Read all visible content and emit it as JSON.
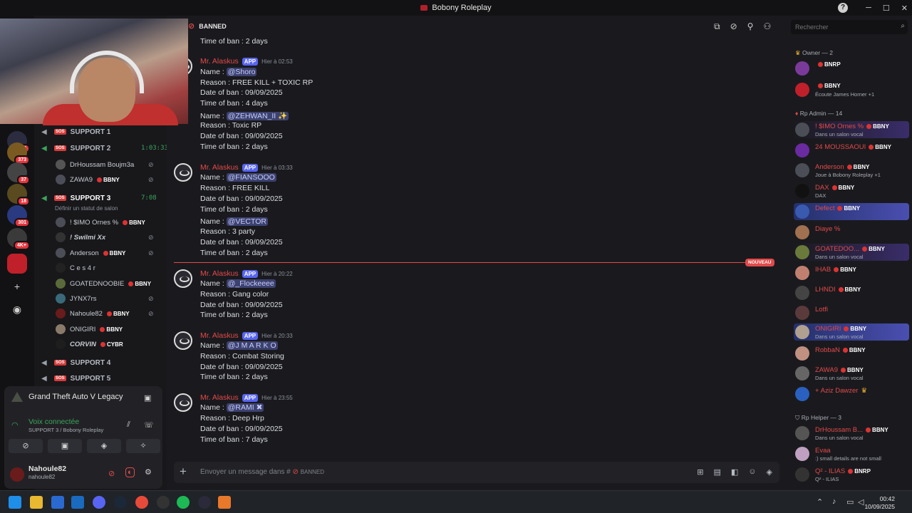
{
  "window": {
    "title": "Bobony Roleplay"
  },
  "servers": [
    {
      "badge": "96"
    },
    {
      "badge": "373"
    },
    {
      "badge": "37"
    },
    {
      "badge": "18"
    },
    {
      "badge": "301"
    },
    {
      "badge": "4K+"
    }
  ],
  "channels": {
    "support1": {
      "name": "SUPPORT 1"
    },
    "support2": {
      "name": "SUPPORT 2",
      "timer": "1:03:33"
    },
    "support2_members": [
      {
        "name": "DrHoussam Boujm3a"
      },
      {
        "name": "ZAWA9",
        "tag": "BBNY"
      }
    ],
    "support3": {
      "name": "SUPPORT 3",
      "timer": "7:08",
      "status": "Définir un statut de salon"
    },
    "support3_members": [
      {
        "name": "! $IMO Ornes %",
        "tag": "BBNY"
      },
      {
        "name": "! Swilmi Xx",
        "tag": ""
      },
      {
        "name": "Anderson",
        "tag": "BBNY"
      },
      {
        "name": "C e s 4 r",
        "tag": ""
      },
      {
        "name": "GOATEDNOOBIE",
        "tag": "BBNY"
      },
      {
        "name": "JYNX7rs",
        "tag": ""
      },
      {
        "name": "Nahoule82",
        "tag": "BBNY"
      },
      {
        "name": "ONIGIRI",
        "tag": "BBNY"
      },
      {
        "name": "CORVIN",
        "tag": "CYBR"
      }
    ],
    "support4": {
      "name": "SUPPORT 4"
    },
    "support5": {
      "name": "SUPPORT 5"
    }
  },
  "voice_panel": {
    "game": "Grand Theft Auto V Legacy",
    "status": "Voix connectée",
    "channel": "SUPPORT 3 / Bobony Roleplay",
    "user": "Nahoule82",
    "username": "nahoule82"
  },
  "chat": {
    "channel": "BANNED",
    "new_label": "NOUVEAU",
    "composer_placeholder": "Envoyer un message dans #",
    "composer_channel": "BANNED",
    "top_line": "Time of ban : 2 days",
    "messages": [
      {
        "author": "Mr. Alaskus",
        "app": "APP",
        "time": "Hier à 02:53",
        "bans": [
          {
            "mention": "@Shoro",
            "reason": "Reason : FREE KILL + TOXIC RP",
            "date": "Date of ban : 09/09/2025",
            "duration": "Time of ban : 4 days"
          },
          {
            "mention": "@ZEHWAN_II ✨",
            "reason": "Reason : Toxic RP",
            "date": "Date of ban : 09/09/2025",
            "duration": "Time of ban : 2 days"
          }
        ]
      },
      {
        "author": "Mr. Alaskus",
        "app": "APP",
        "time": "Hier à 03:33",
        "bans": [
          {
            "mention": "@FIANSOOO",
            "reason": "Reason : FREE KILL",
            "date": "Date of ban : 09/09/2025",
            "duration": "Time of ban : 2 days"
          },
          {
            "mention": "@VECTOR",
            "reason": "Reason : 3 party",
            "date": "Date of ban : 09/09/2025",
            "duration": "Time of ban : 2 days"
          }
        ]
      },
      {
        "author": "Mr. Alaskus",
        "app": "APP",
        "time": "Hier à 20:22",
        "bans": [
          {
            "mention": "@_Flockeeee",
            "reason": "Reason : Gang color",
            "date": "Date of ban : 09/09/2025",
            "duration": "Time of ban : 2 days"
          }
        ]
      },
      {
        "author": "Mr. Alaskus",
        "app": "APP",
        "time": "Hier à 20:33",
        "bans": [
          {
            "mention": "@J M A R K O",
            "reason": "Reason : Combat Storing",
            "date": "Date of ban : 09/09/2025",
            "duration": "Time of ban : 2 days"
          }
        ]
      },
      {
        "author": "Mr. Alaskus",
        "app": "APP",
        "time": "Hier à 23:55",
        "bans": [
          {
            "mention": "@RAMI ✖",
            "reason": "Reason : Deep Hrp",
            "date": "Date of ban : 09/09/2025",
            "duration": "Time of ban : 7 days"
          }
        ]
      }
    ]
  },
  "members": {
    "search_placeholder": "Rechercher",
    "owner_header": "Owner — 2",
    "owners": [
      {
        "name": "",
        "tag": "BNRP",
        "status": ""
      },
      {
        "name": "",
        "tag": "BBNY",
        "status": "Écoute James Horner +1"
      }
    ],
    "admin_header": "Rp Admin — 14",
    "admins": [
      {
        "name": "! $IMO Ornes %",
        "tag": "BBNY",
        "status": "Dans un salon vocal"
      },
      {
        "name": "24 MOUSSAOUI",
        "tag": "BBNY",
        "status": ""
      },
      {
        "name": "Anderson",
        "tag": "BBNY",
        "status": "Joue à Bobony Roleplay +1"
      },
      {
        "name": "DAX",
        "tag": "BBNY",
        "status": "DAX"
      },
      {
        "name": "Defect",
        "tag": "BBNY",
        "status": ""
      },
      {
        "name": "Diaye %",
        "tag": "",
        "status": ""
      },
      {
        "name": "GOATEDOO...",
        "tag": "BBNY",
        "status": "Dans un salon vocal"
      },
      {
        "name": "IHAB",
        "tag": "BBNY",
        "status": ""
      },
      {
        "name": "LHNDI",
        "tag": "BBNY",
        "status": ""
      },
      {
        "name": "Lotfi",
        "tag": "",
        "status": ""
      },
      {
        "name": "ONIGIRI",
        "tag": "BBNY",
        "status": "Dans un salon vocal"
      },
      {
        "name": "RobbaN",
        "tag": "BBNY",
        "status": ""
      },
      {
        "name": "ZAWA9",
        "tag": "BBNY",
        "status": "Dans un salon vocal"
      },
      {
        "name": "+ Aziz Dawzer",
        "tag": "",
        "status": ""
      }
    ],
    "helper_header": "Rp Helper — 3",
    "helpers": [
      {
        "name": "DrHoussam B...",
        "tag": "BBNY",
        "status": "Dans un salon vocal"
      },
      {
        "name": "Evaa",
        "tag": "",
        "status": ":) small details are not small"
      },
      {
        "name": "Q² - ILIAS",
        "tag": "BNRP",
        "status": "Q² - ILIAS"
      }
    ]
  },
  "taskbar": {
    "time": "00:42",
    "date": "10/09/2025"
  }
}
